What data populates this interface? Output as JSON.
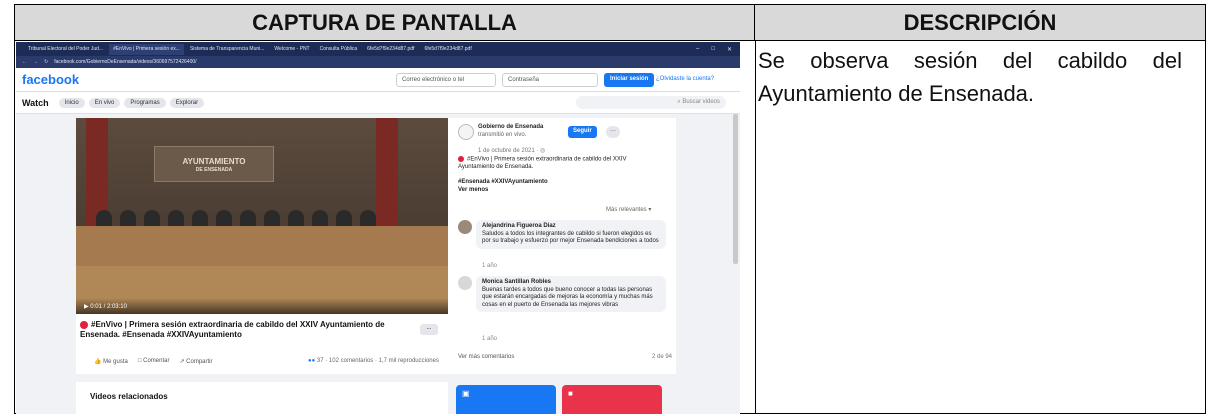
{
  "table": {
    "header_left": "CAPTURA DE PANTALLA",
    "header_right": "DESCRIPCIÓN",
    "description_line1": "Se observa sesión del cabildo del",
    "description_line2": "Ayuntamiento de Ensenada."
  },
  "browser": {
    "tabs": [
      "Tribunal Electoral del Poder Jud...",
      "#EnVivo | Primera sesión ex...",
      "Sistema de Transparencia Muni...",
      "Welcome - PNT",
      "Consulta Pública",
      "6fe5d7f9e234d87.pdf",
      "6fe5d7f9e234d87.pdf"
    ],
    "url": "facebook.com/GobiernoDeEnsenada/videos/360697572426400/"
  },
  "fb": {
    "logo": "facebook",
    "email_placeholder": "Correo electrónico o tel",
    "password_placeholder": "Contraseña",
    "login_button": "Iniciar sesión",
    "forgot_link": "¿Olvidaste la cuenta?",
    "watch_title": "Watch",
    "chips": [
      "Inicio",
      "En vivo",
      "Programas",
      "Explorar"
    ],
    "search_placeholder": "Buscar videos"
  },
  "video": {
    "banner_main": "AYUNTAMIENTO",
    "banner_sub": "DE ENSENADA",
    "time": "0:01 / 2:03:10",
    "title": "#EnVivo | Primera sesión extraordinaria de cabildo del XXIV Ayuntamiento de Ensenada. #Ensenada #XXIVAyuntamiento",
    "more": "...",
    "actions": [
      "Me gusta",
      "Comentar",
      "Compartir"
    ],
    "reactions": "37 · 102 comentarios · 1,7 mil reproducciones"
  },
  "post": {
    "page_name": "Gobierno de Ensenada",
    "transmitted": "transmitió en vivo.",
    "follow": "Seguir",
    "dots": "···",
    "date": "1 de octubre de 2021 · ",
    "text": "#EnVivo | Primera sesión extraordinaria de cabildo del XXIV Ayuntamiento de Ensenada.",
    "tags": "#Ensenada #XXIVAyuntamiento",
    "see_less": "Ver menos",
    "sort": "Más relevantes ▾"
  },
  "comments": [
    {
      "author": "Alejandrina Figueroa Diaz",
      "text": "Saludos a todos los integrantes de cabildo si fueron elegidos es por su trabajo y esfuerzo por mejor Ensenada bendiciones a todos",
      "time": "1 año"
    },
    {
      "author": "Monica Santillan Robles",
      "text": "Buenas tardes a todos que bueno conocer a todas las personas que estarán encargadas de mejoras la economía y muchas más cosas en el puerto de Ensenada las mejores vibras",
      "time": "1 año"
    }
  ],
  "comments_more": "Ver más comentarios",
  "comments_page": "2 de 94",
  "related": "Videos relacionados"
}
